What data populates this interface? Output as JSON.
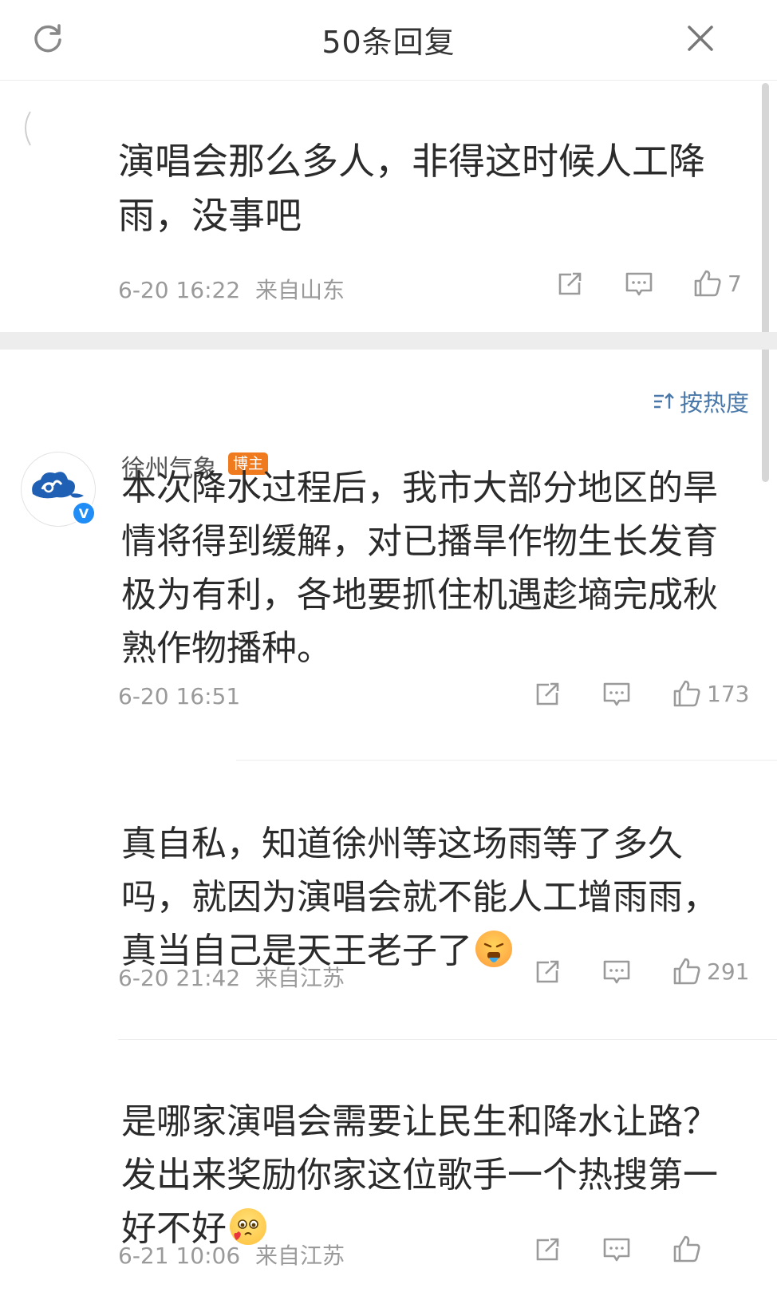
{
  "header": {
    "title": "50条回复"
  },
  "main_post": {
    "text": "演唱会那么多人，非得这时候人工降雨，没事吧",
    "time": "6-20 16:22",
    "location": "来自山东",
    "likes": "7"
  },
  "sort": {
    "label": "按热度"
  },
  "replies": [
    {
      "author": "徐州气象",
      "badge": "博主",
      "text": "本次降水过程后，我市大部分地区的旱情将得到缓解，对已播旱作物生长发育极为有利，各地要抓住机遇趁墒完成秋熟作物播种。",
      "time": "6-20 16:51",
      "location": "",
      "likes": "173"
    },
    {
      "text": "真自私，知道徐州等这场雨等了多久吗，就因为演唱会就不能人工增雨雨，真当自己是天王老子了",
      "time": "6-20 21:42",
      "location": "来自江苏",
      "likes": "291"
    },
    {
      "text": "是哪家演唱会需要让民生和降水让路？发出来奖励你家这位歌手一个热搜第一好不好",
      "time": "6-21 10:06",
      "location": "来自江苏",
      "likes": ""
    }
  ],
  "icons": {
    "refresh": "refresh-icon",
    "close": "close-icon",
    "share": "share-icon",
    "comment": "comment-icon",
    "like": "thumbs-up-icon",
    "sort": "sort-icon"
  },
  "colors": {
    "sort_link": "#4a78a8",
    "badge": "#f07a1e",
    "verified": "#1f8df5"
  }
}
